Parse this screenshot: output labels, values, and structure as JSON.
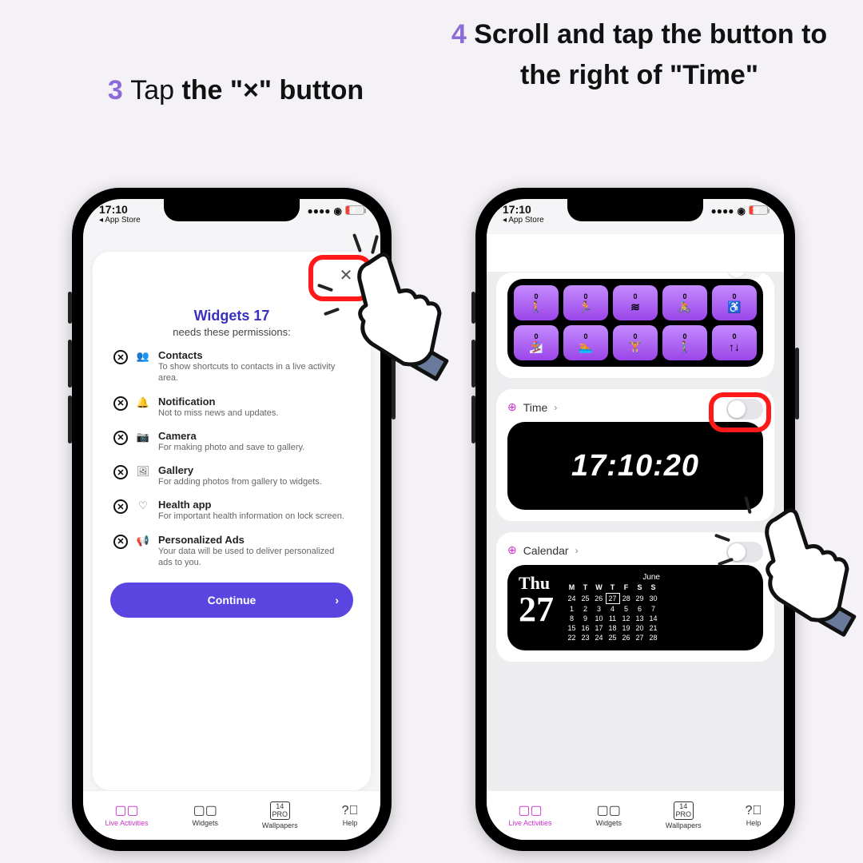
{
  "instructions": {
    "step3": {
      "num": "3",
      "light": "Tap ",
      "bold": "the \"×\" button"
    },
    "step4": {
      "num": "4",
      "text": "Scroll and tap the button to the right of \"Time\""
    }
  },
  "status": {
    "time": "17:10",
    "back": "◂ App Store",
    "battery": "12"
  },
  "perm": {
    "title": "Widgets 17",
    "sub": "needs these permissions:",
    "items": [
      {
        "icon": "👥",
        "title": "Contacts",
        "desc": "To show shortcuts to contacts in a live activity area."
      },
      {
        "icon": "🔔",
        "title": "Notification",
        "desc": "Not to miss news and updates."
      },
      {
        "icon": "📷",
        "title": "Camera",
        "desc": "For making photo and save to gallery."
      },
      {
        "icon": "🖼",
        "title": "Gallery",
        "desc": "For adding photos from gallery to widgets."
      },
      {
        "icon": "♡",
        "title": "Health app",
        "desc": "For important health information on lock screen."
      },
      {
        "icon": "📢",
        "title": "Personalized Ads",
        "desc": "Your data will be used to deliver personalized ads to you."
      }
    ],
    "continue": "Continue"
  },
  "tabs": [
    {
      "label": "Live Activities",
      "active": true
    },
    {
      "label": "Widgets"
    },
    {
      "label": "Wallpapers",
      "boxed": "14\nPRO"
    },
    {
      "label": "Help"
    }
  ],
  "phone2": {
    "activity_icons": [
      "🚶",
      "🏃",
      "≋",
      "🚴",
      "♿",
      "🏂",
      "🏊",
      "🏋",
      "🚶‍♂️",
      "↑↓"
    ],
    "activity_value": "0",
    "time_label": "Time",
    "time_value": "17:10:20",
    "calendar_label": "Calendar",
    "cal": {
      "dow": "Thu",
      "dnum": "27",
      "month": "June",
      "head": [
        "M",
        "T",
        "W",
        "T",
        "F",
        "S",
        "S"
      ],
      "rows": [
        [
          "24",
          "25",
          "26",
          "27",
          "28",
          "29",
          "30"
        ],
        [
          "1",
          "2",
          "3",
          "4",
          "5",
          "6",
          "7"
        ],
        [
          "8",
          "9",
          "10",
          "11",
          "12",
          "13",
          "14"
        ],
        [
          "15",
          "16",
          "17",
          "18",
          "19",
          "20",
          "21"
        ],
        [
          "22",
          "23",
          "24",
          "25",
          "26",
          "27",
          "28"
        ]
      ]
    }
  }
}
